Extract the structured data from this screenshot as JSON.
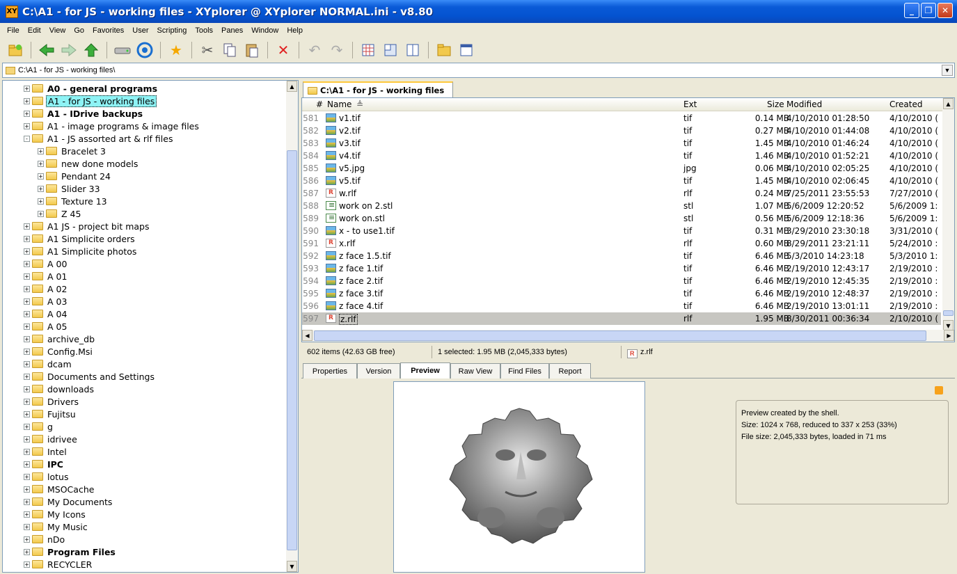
{
  "window": {
    "title": "C:\\A1 - for JS - working files - XYplorer @ XYplorer NORMAL.ini - v8.80",
    "app_icon_text": "XY"
  },
  "menu": [
    "File",
    "Edit",
    "View",
    "Go",
    "Favorites",
    "User",
    "Scripting",
    "Tools",
    "Panes",
    "Window",
    "Help"
  ],
  "toolbar": [
    "new-folder-icon",
    "back-icon",
    "forward-icon",
    "up-icon",
    "drive-icon",
    "target-icon",
    "favorite-star-icon",
    "cut-icon",
    "copy-icon",
    "paste-icon",
    "delete-icon",
    "undo-icon",
    "redo-icon",
    "grid-icon",
    "pane-layout-icon",
    "dual-pane-icon",
    "folder-props-icon",
    "preview-pane-icon"
  ],
  "address": {
    "path": "C:\\A1 - for JS - working files\\"
  },
  "tree": [
    {
      "label": "A0 - general programs",
      "bold": true,
      "depth": 0,
      "exp": "+"
    },
    {
      "label": "A1 - for JS - working files",
      "bold": false,
      "depth": 0,
      "exp": "+",
      "selected": true
    },
    {
      "label": "A1 - IDrive backups",
      "bold": true,
      "depth": 0,
      "exp": "+"
    },
    {
      "label": "A1 - image programs & image files",
      "bold": false,
      "depth": 0,
      "exp": "+"
    },
    {
      "label": "A1 - JS assorted art & rlf files",
      "bold": false,
      "depth": 0,
      "exp": "-"
    },
    {
      "label": "Bracelet 3",
      "bold": false,
      "depth": 1,
      "exp": "+"
    },
    {
      "label": "new done models",
      "bold": false,
      "depth": 1,
      "exp": "+"
    },
    {
      "label": "Pendant 24",
      "bold": false,
      "depth": 1,
      "exp": "+"
    },
    {
      "label": "Slider 33",
      "bold": false,
      "depth": 1,
      "exp": "+"
    },
    {
      "label": "Texture 13",
      "bold": false,
      "depth": 1,
      "exp": "+"
    },
    {
      "label": "Z 45",
      "bold": false,
      "depth": 1,
      "exp": "+"
    },
    {
      "label": "A1 JS - project bit maps",
      "bold": false,
      "depth": 0,
      "exp": "+"
    },
    {
      "label": "A1 Simplicite orders",
      "bold": false,
      "depth": 0,
      "exp": "+"
    },
    {
      "label": "A1 Simplicite photos",
      "bold": false,
      "depth": 0,
      "exp": "+"
    },
    {
      "label": "A 00",
      "bold": false,
      "depth": 0,
      "exp": "+"
    },
    {
      "label": "A 01",
      "bold": false,
      "depth": 0,
      "exp": "+"
    },
    {
      "label": "A 02",
      "bold": false,
      "depth": 0,
      "exp": "+"
    },
    {
      "label": "A 03",
      "bold": false,
      "depth": 0,
      "exp": "+"
    },
    {
      "label": "A 04",
      "bold": false,
      "depth": 0,
      "exp": "+"
    },
    {
      "label": "A 05",
      "bold": false,
      "depth": 0,
      "exp": "+"
    },
    {
      "label": "archive_db",
      "bold": false,
      "depth": 0,
      "exp": "+"
    },
    {
      "label": "Config.Msi",
      "bold": false,
      "depth": 0,
      "exp": "+"
    },
    {
      "label": "dcam",
      "bold": false,
      "depth": 0,
      "exp": "+"
    },
    {
      "label": "Documents and Settings",
      "bold": false,
      "depth": 0,
      "exp": "+"
    },
    {
      "label": "downloads",
      "bold": false,
      "depth": 0,
      "exp": "+"
    },
    {
      "label": "Drivers",
      "bold": false,
      "depth": 0,
      "exp": "+"
    },
    {
      "label": "Fujitsu",
      "bold": false,
      "depth": 0,
      "exp": "+"
    },
    {
      "label": "g",
      "bold": false,
      "depth": 0,
      "exp": "+"
    },
    {
      "label": "idrivee",
      "bold": false,
      "depth": 0,
      "exp": "+"
    },
    {
      "label": "Intel",
      "bold": false,
      "depth": 0,
      "exp": "+"
    },
    {
      "label": "IPC",
      "bold": true,
      "depth": 0,
      "exp": "+"
    },
    {
      "label": "lotus",
      "bold": false,
      "depth": 0,
      "exp": "+"
    },
    {
      "label": "MSOCache",
      "bold": false,
      "depth": 0,
      "exp": "+"
    },
    {
      "label": "My Documents",
      "bold": false,
      "depth": 0,
      "exp": "+"
    },
    {
      "label": "My Icons",
      "bold": false,
      "depth": 0,
      "exp": "+"
    },
    {
      "label": "My Music",
      "bold": false,
      "depth": 0,
      "exp": "+"
    },
    {
      "label": "nDo",
      "bold": false,
      "depth": 0,
      "exp": "+"
    },
    {
      "label": "Program Files",
      "bold": true,
      "depth": 0,
      "exp": "+"
    },
    {
      "label": "RECYCLER",
      "bold": false,
      "depth": 0,
      "exp": "+"
    }
  ],
  "folder_tab": {
    "label": "C:\\A1 - for JS - working files"
  },
  "columns": {
    "num": "#",
    "name": "Name",
    "sort": "≜",
    "ext": "Ext",
    "size": "Size",
    "modified": "Modified",
    "created": "Created"
  },
  "files": [
    {
      "num": "581",
      "name": "v1.tif",
      "type": "tif",
      "ext": "tif",
      "size": "0.14 MB",
      "modified": "4/10/2010 01:28:50",
      "created": "4/10/2010 ("
    },
    {
      "num": "582",
      "name": "v2.tif",
      "type": "tif",
      "ext": "tif",
      "size": "0.27 MB",
      "modified": "4/10/2010 01:44:08",
      "created": "4/10/2010 ("
    },
    {
      "num": "583",
      "name": "v3.tif",
      "type": "tif",
      "ext": "tif",
      "size": "1.45 MB",
      "modified": "4/10/2010 01:46:24",
      "created": "4/10/2010 ("
    },
    {
      "num": "584",
      "name": "v4.tif",
      "type": "tif",
      "ext": "tif",
      "size": "1.46 MB",
      "modified": "4/10/2010 01:52:21",
      "created": "4/10/2010 ("
    },
    {
      "num": "585",
      "name": "v5.jpg",
      "type": "tif",
      "ext": "jpg",
      "size": "0.06 MB",
      "modified": "4/10/2010 02:05:25",
      "created": "4/10/2010 ("
    },
    {
      "num": "586",
      "name": "v5.tif",
      "type": "tif",
      "ext": "tif",
      "size": "1.45 MB",
      "modified": "4/10/2010 02:06:45",
      "created": "4/10/2010 ("
    },
    {
      "num": "587",
      "name": "w.rlf",
      "type": "rlf",
      "ext": "rlf",
      "size": "0.24 MB",
      "modified": "7/25/2011 23:55:53",
      "created": "7/27/2010 ("
    },
    {
      "num": "588",
      "name": "work on 2.stl",
      "type": "stl",
      "ext": "stl",
      "size": "1.07 MB",
      "modified": "5/6/2009 12:20:52",
      "created": "5/6/2009 1:"
    },
    {
      "num": "589",
      "name": "work on.stl",
      "type": "stl",
      "ext": "stl",
      "size": "0.56 MB",
      "modified": "5/6/2009 12:18:36",
      "created": "5/6/2009 1:"
    },
    {
      "num": "590",
      "name": "x - to use1.tif",
      "type": "tif",
      "ext": "tif",
      "size": "0.31 MB",
      "modified": "3/29/2010 23:30:18",
      "created": "3/31/2010 ("
    },
    {
      "num": "591",
      "name": "x.rlf",
      "type": "rlf",
      "ext": "rlf",
      "size": "0.60 MB",
      "modified": "8/29/2011 23:21:11",
      "created": "5/24/2010 :"
    },
    {
      "num": "592",
      "name": "z face 1.5.tif",
      "type": "tif",
      "ext": "tif",
      "size": "6.46 MB",
      "modified": "5/3/2010 14:23:18",
      "created": "5/3/2010 1:"
    },
    {
      "num": "593",
      "name": "z face 1.tif",
      "type": "tif",
      "ext": "tif",
      "size": "6.46 MB",
      "modified": "2/19/2010 12:43:17",
      "created": "2/19/2010 :"
    },
    {
      "num": "594",
      "name": "z face 2.tif",
      "type": "tif",
      "ext": "tif",
      "size": "6.46 MB",
      "modified": "2/19/2010 12:45:35",
      "created": "2/19/2010 :"
    },
    {
      "num": "595",
      "name": "z face 3.tif",
      "type": "tif",
      "ext": "tif",
      "size": "6.46 MB",
      "modified": "2/19/2010 12:48:37",
      "created": "2/19/2010 :"
    },
    {
      "num": "596",
      "name": "z face 4.tif",
      "type": "tif",
      "ext": "tif",
      "size": "6.46 MB",
      "modified": "2/19/2010 13:01:11",
      "created": "2/19/2010 :"
    },
    {
      "num": "597",
      "name": "z.rlf",
      "type": "rlf",
      "ext": "rlf",
      "size": "1.95 MB",
      "modified": "8/30/2011 00:36:34",
      "created": "2/10/2010 (",
      "selected": true
    }
  ],
  "status": {
    "items": "602 items (42.63 GB free)",
    "selected": "1 selected: 1.95 MB (2,045,333 bytes)",
    "current": "z.rlf"
  },
  "info_tabs": [
    "Properties",
    "Version",
    "Preview",
    "Raw View",
    "Find Files",
    "Report"
  ],
  "active_info_tab": "Preview",
  "preview_info": [
    "Preview created by the shell.",
    "Size: 1024 x 768, reduced to 337 x 253 (33%)",
    "File size: 2,045,333 bytes, loaded in 71 ms"
  ]
}
